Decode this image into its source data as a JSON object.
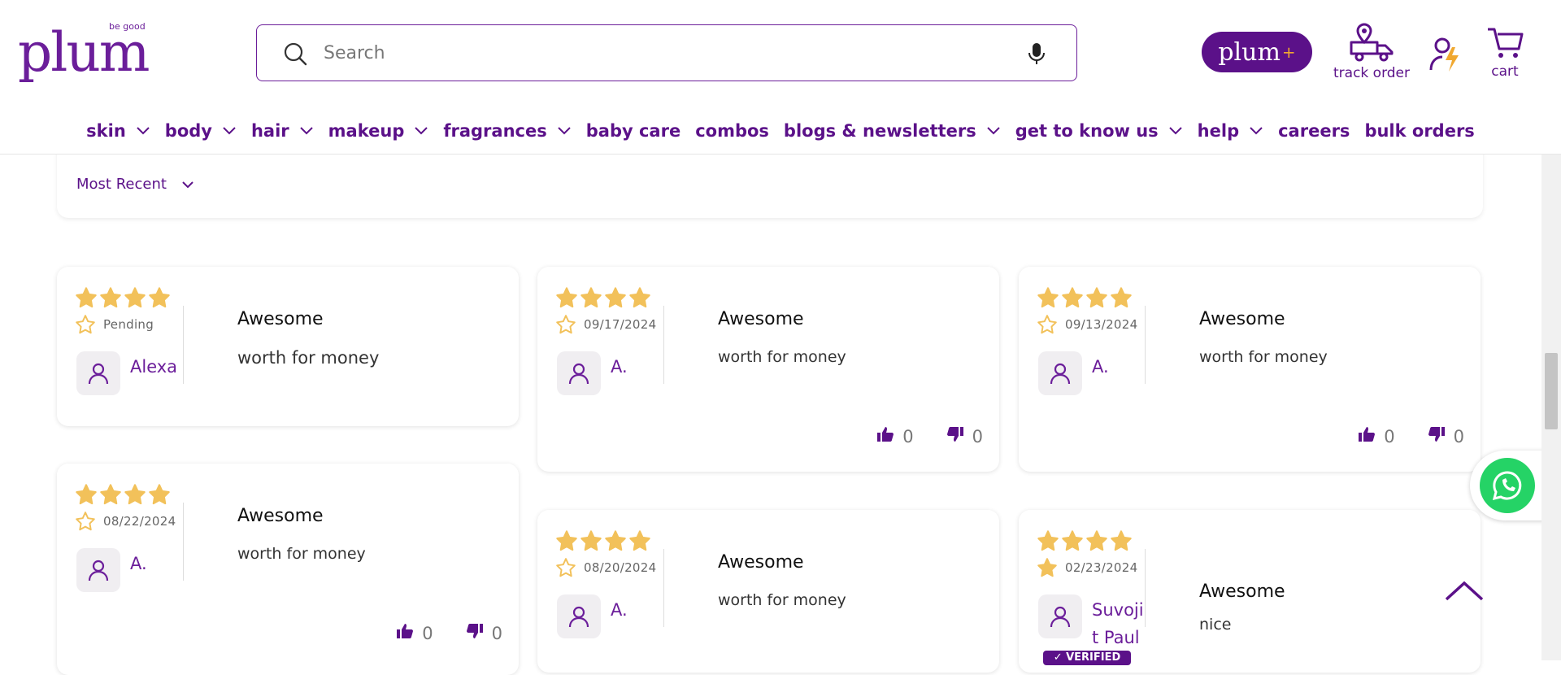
{
  "brand": {
    "logo_text": "plum",
    "tagline": "be good",
    "plus_label": "plum",
    "plus_sign": "+"
  },
  "search": {
    "placeholder": "Search"
  },
  "header_actions": {
    "track_order": "track order",
    "cart": "cart"
  },
  "nav": {
    "items": [
      {
        "label": "skin",
        "dropdown": true
      },
      {
        "label": "body",
        "dropdown": true
      },
      {
        "label": "hair",
        "dropdown": true
      },
      {
        "label": "makeup",
        "dropdown": true
      },
      {
        "label": "fragrances",
        "dropdown": true
      },
      {
        "label": "baby care",
        "dropdown": false
      },
      {
        "label": "combos",
        "dropdown": false
      },
      {
        "label": "blogs & newsletters",
        "dropdown": true
      },
      {
        "label": "get to know us",
        "dropdown": true
      },
      {
        "label": "help",
        "dropdown": true
      },
      {
        "label": "careers",
        "dropdown": false
      },
      {
        "label": "bulk orders",
        "dropdown": false
      }
    ]
  },
  "sort": {
    "selected": "Most Recent"
  },
  "reviews": [
    {
      "rating": 4,
      "date": "Pending",
      "author": "Alexa",
      "title": "Awesome",
      "body": "worth for money",
      "up": "",
      "down": ""
    },
    {
      "rating": 4,
      "date": "09/17/2024",
      "author": "A.",
      "title": "Awesome",
      "body": "worth for money",
      "up": "0",
      "down": "0"
    },
    {
      "rating": 4,
      "date": "09/13/2024",
      "author": "A.",
      "title": "Awesome",
      "body": "worth for money",
      "up": "0",
      "down": "0"
    },
    {
      "rating": 4,
      "date": "08/22/2024",
      "author": "A.",
      "title": "Awesome",
      "body": "worth for money",
      "up": "0",
      "down": "0"
    },
    {
      "rating": 4,
      "date": "08/20/2024",
      "author": "A.",
      "title": "Awesome",
      "body": "worth for money",
      "up": "",
      "down": ""
    },
    {
      "rating": 5,
      "date": "02/23/2024",
      "author": "Suvojit Paul",
      "author_line1": "Suvoji",
      "author_line2": "t Paul",
      "title": "Awesome",
      "body": "nice",
      "verified": "✓ VERIFIED",
      "up": "",
      "down": ""
    }
  ],
  "colors": {
    "brand_purple": "#5b1189",
    "star_gold": "#f2c15a",
    "whatsapp_green": "#25d366"
  }
}
